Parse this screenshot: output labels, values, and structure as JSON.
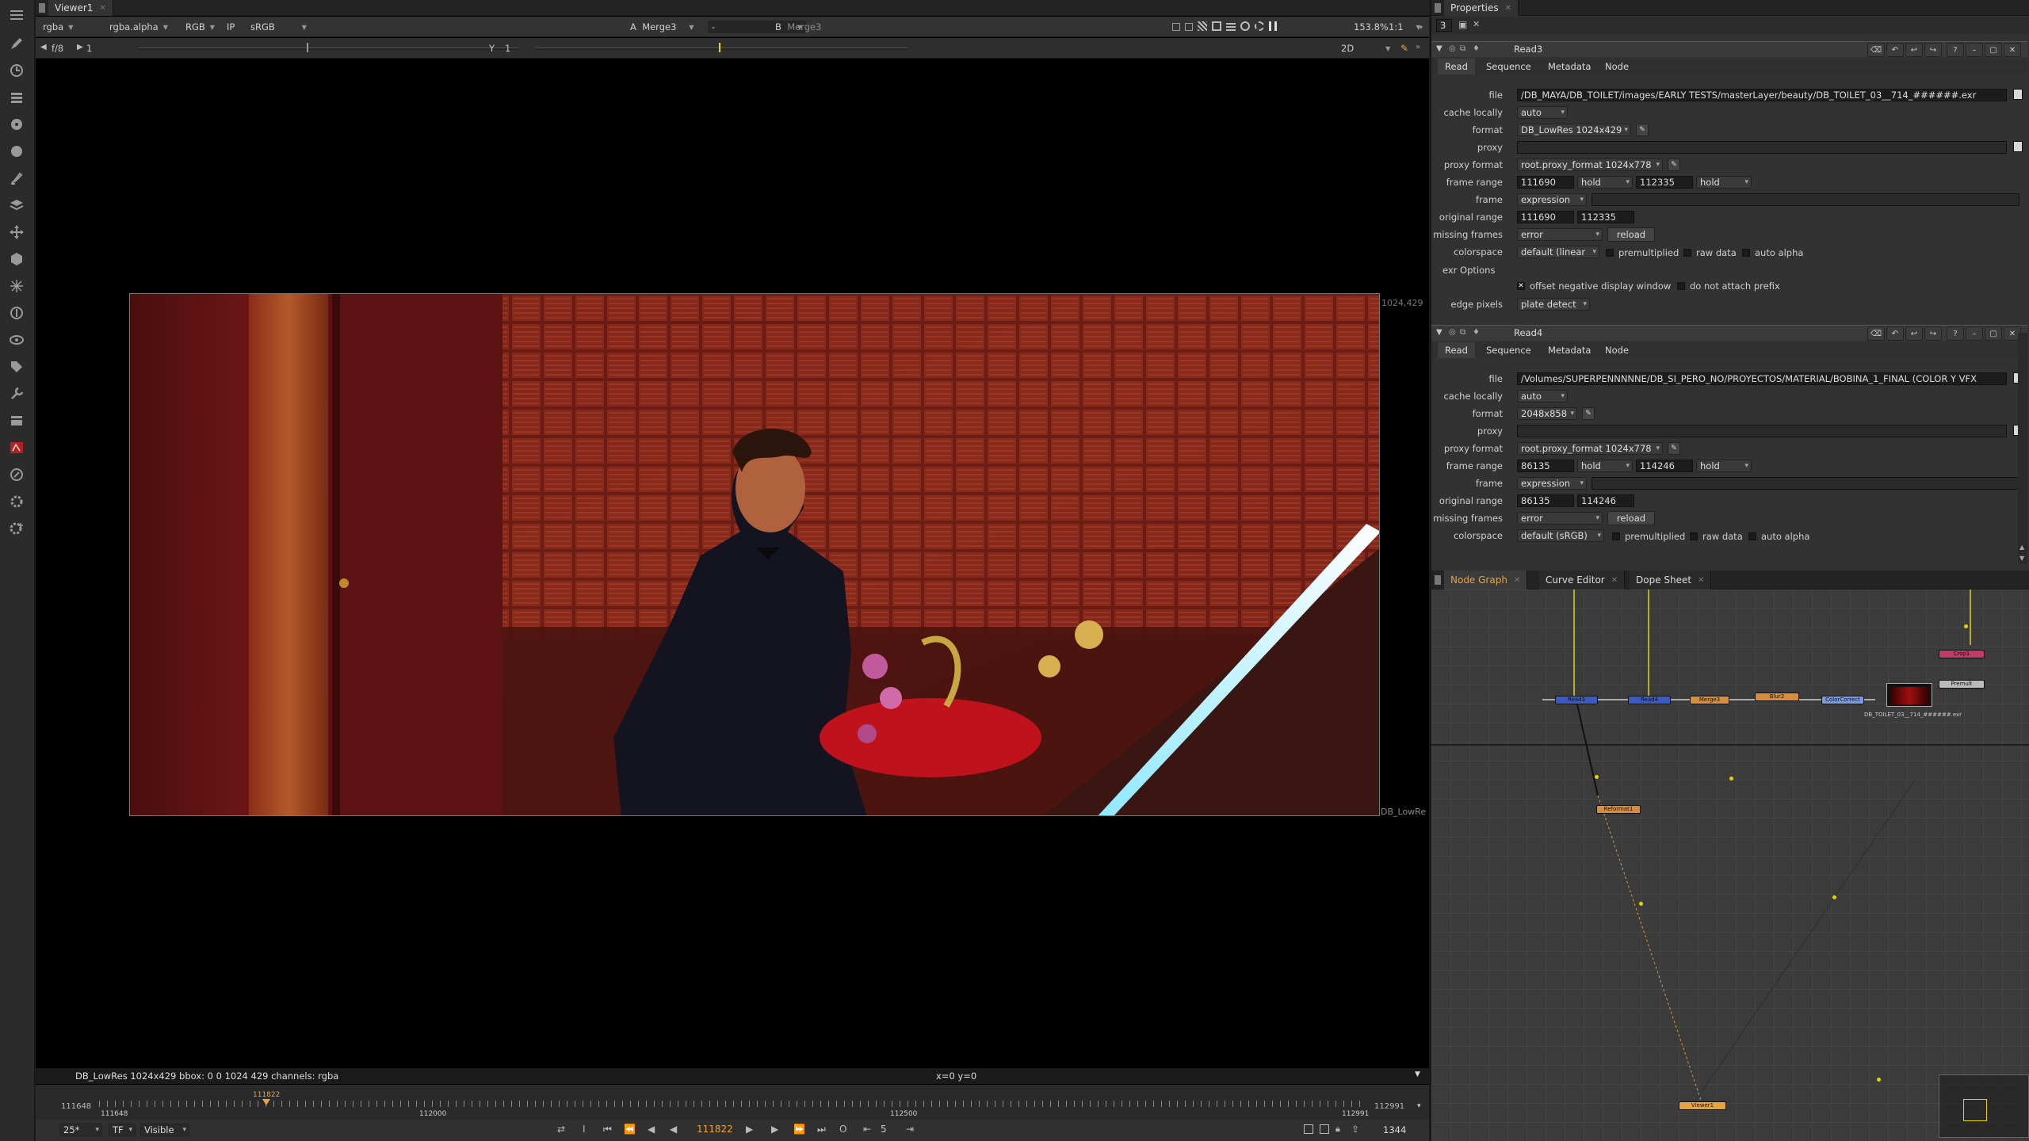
{
  "left_toolbar": {
    "tools": [
      "panel-menu-icon",
      "pen-icon",
      "clock-icon",
      "stack-icon",
      "color-wheel-icon",
      "circle-icon",
      "paint-icon",
      "layers-icon",
      "move-icon",
      "cube-icon",
      "sparkle-icon",
      "keyer-icon",
      "eye-icon",
      "tag-icon",
      "wrench-icon",
      "film-icon",
      "red-node-icon",
      "lens-icon",
      "gizmo-icon",
      "gizmo-add-icon"
    ]
  },
  "viewer": {
    "tab_label": "Viewer1",
    "channels": "rgba",
    "alpha": "rgba.alpha",
    "display": "RGB",
    "ip": "IP",
    "lut": "sRGB",
    "input_a_label": "A",
    "input_a": "Merge3",
    "ab_op": "-",
    "input_b_label": "B",
    "input_b": "Merge3",
    "zoom": "153.8%",
    "ratio": "1:1",
    "fstop": "f/8",
    "gain_value": "1",
    "gamma_label": "Y",
    "gamma_value": "1",
    "view_mode": "2D",
    "resolution_label": "1024,429",
    "format_corner_label": "DB_LowRe",
    "status_info": "DB_LowRes 1024x429  bbox: 0 0 1024 429 channels: rgba",
    "cursor_info": "x=0 y=0"
  },
  "timeline": {
    "start": "111648",
    "end": "112991",
    "tick_labels": [
      "111648",
      "112000",
      "112500",
      "112991"
    ],
    "current_marker": "111822",
    "fps": "25*",
    "tf": "TF",
    "visibility": "Visible",
    "current_frame": "111822",
    "increment": "5",
    "frame_count": "1344"
  },
  "properties": {
    "title": "Properties",
    "max_panels": "3",
    "read3": {
      "name": "Read3",
      "tabs": [
        "Read",
        "Sequence",
        "Metadata",
        "Node"
      ],
      "file_label": "file",
      "file": "/DB_MAYA/DB_TOILET/images/EARLY TESTS/masterLayer/beauty/DB_TOILET_03__714_######.exr",
      "cache_label": "cache locally",
      "cache": "auto",
      "format_label": "format",
      "format": "DB_LowRes 1024x429",
      "proxy_label": "proxy",
      "proxy_format_label": "proxy format",
      "proxy_format": "root.proxy_format 1024x778",
      "frame_range_label": "frame range",
      "frame_start": "111690",
      "before": "hold",
      "frame_end": "112335",
      "after": "hold",
      "frame_label": "frame",
      "frame_mode": "expression",
      "original_range_label": "original range",
      "orig_start": "111690",
      "orig_end": "112335",
      "missing_label": "missing frames",
      "missing": "error",
      "reload": "reload",
      "colorspace_label": "colorspace",
      "colorspace": "default (linear",
      "premultiplied": "premultiplied",
      "raw_data": "raw data",
      "auto_alpha": "auto alpha",
      "exr_options": "exr Options",
      "offset_neg": "offset negative display window",
      "no_prefix": "do not attach prefix",
      "edge_label": "edge pixels",
      "edge": "plate detect"
    },
    "read4": {
      "name": "Read4",
      "tabs": [
        "Read",
        "Sequence",
        "Metadata",
        "Node"
      ],
      "file_label": "file",
      "file": "/Volumes/SUPERPENNNNNE/DB_SI_PERO_NO/PROYECTOS/MATERIAL/BOBINA_1_FINAL (COLOR Y VFX",
      "cache_label": "cache locally",
      "cache": "auto",
      "format_label": "format",
      "format": "2048x858",
      "proxy_label": "proxy",
      "proxy_format_label": "proxy format",
      "proxy_format": "root.proxy_format 1024x778",
      "frame_range_label": "frame range",
      "frame_start": "86135",
      "before": "hold",
      "frame_end": "114246",
      "after": "hold",
      "frame_label": "frame",
      "frame_mode": "expression",
      "original_range_label": "original range",
      "orig_start": "86135",
      "orig_end": "114246",
      "missing_label": "missing frames",
      "missing": "error",
      "reload": "reload",
      "colorspace_label": "colorspace",
      "colorspace": "default (sRGB)",
      "premultiplied": "premultiplied",
      "raw_data": "raw data",
      "auto_alpha": "auto alpha"
    }
  },
  "node_graph": {
    "tabs": [
      "Node Graph",
      "Curve Editor",
      "Dope Sheet"
    ],
    "nodes": {
      "read3": "Read3",
      "read4": "Read4",
      "merge": "Merge3",
      "blur": "Blur2",
      "grade": "ColorCorrect",
      "reformat": "Reformat1",
      "viewer": "Viewer1",
      "premult": "Premult",
      "crop": "Crop1",
      "thumb_caption": "DB_TOILET_03__714_######.exr"
    }
  },
  "colors": {
    "accent_orange": "#e8a33d",
    "node_read_blue": "#3a5ac8",
    "node_merge_orange": "#d98c3a",
    "viewer_bg": "#000000"
  }
}
